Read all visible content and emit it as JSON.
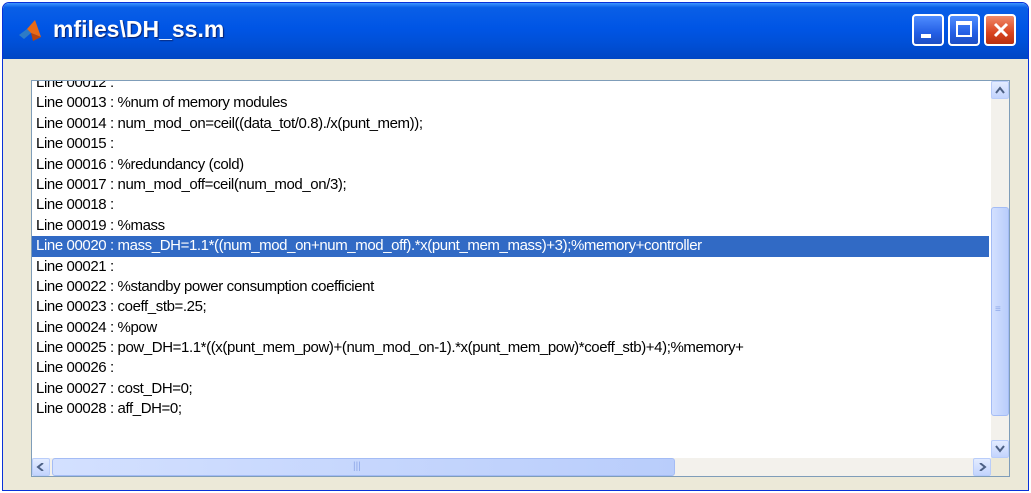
{
  "window": {
    "title": "mfiles\\DH_ss.m"
  },
  "icons": {
    "app": "matlab-icon",
    "minimize": "minimize-icon",
    "maximize": "maximize-icon",
    "close": "close-icon"
  },
  "code": {
    "selected_index": 8,
    "lines": [
      "Line 00012 :",
      "Line 00013 : %num of memory modules",
      "Line 00014 : num_mod_on=ceil((data_tot/0.8)./x(punt_mem));",
      "Line 00015 :",
      "Line 00016 : %redundancy (cold)",
      "Line 00017 : num_mod_off=ceil(num_mod_on/3);",
      "Line 00018 :",
      "Line 00019 : %mass",
      "Line 00020 : mass_DH=1.1*((num_mod_on+num_mod_off).*x(punt_mem_mass)+3);%memory+controller",
      "Line 00021 :",
      "Line 00022 : %standby power consumption coefficient",
      "Line 00023 : coeff_stb=.25;",
      "Line 00024 : %pow",
      "Line 00025 : pow_DH=1.1*((x(punt_mem_pow)+(num_mod_on-1).*x(punt_mem_pow)*coeff_stb)+4);%memory+",
      "Line 00026 :",
      "Line 00027 : cost_DH=0;",
      "Line 00028 : aff_DH=0;"
    ]
  },
  "colors": {
    "titlebar": "#0055e5",
    "selection": "#316ac5",
    "close_button": "#d9441f"
  }
}
